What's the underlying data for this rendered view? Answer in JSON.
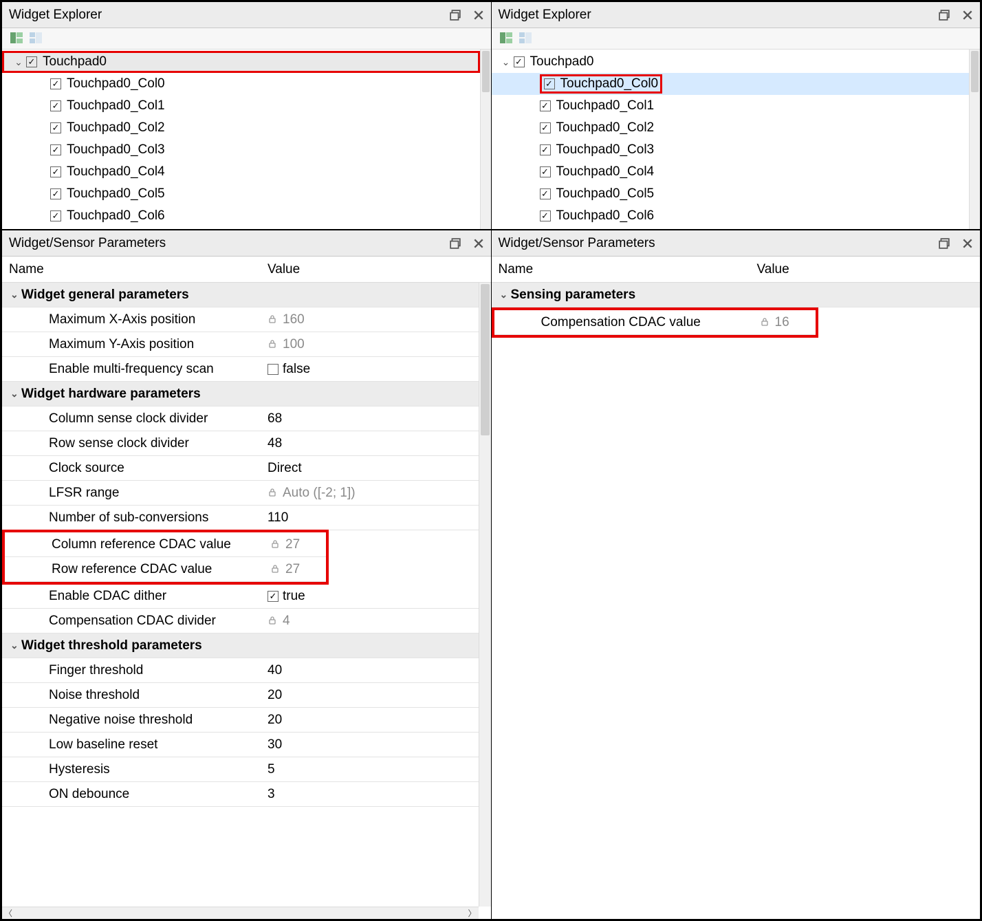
{
  "left": {
    "explorer": {
      "title": "Widget Explorer",
      "root": "Touchpad0",
      "children": [
        "Touchpad0_Col0",
        "Touchpad0_Col1",
        "Touchpad0_Col2",
        "Touchpad0_Col3",
        "Touchpad0_Col4",
        "Touchpad0_Col5",
        "Touchpad0_Col6"
      ]
    },
    "params": {
      "title": "Widget/Sensor Parameters",
      "col_name": "Name",
      "col_value": "Value",
      "groups": [
        {
          "label": "Widget general parameters",
          "items": [
            {
              "name": "Maximum X-Axis position",
              "value": "160",
              "locked": true
            },
            {
              "name": "Maximum Y-Axis position",
              "value": "100",
              "locked": true
            },
            {
              "name": "Enable multi-frequency scan",
              "value": "false",
              "check": false
            }
          ]
        },
        {
          "label": "Widget hardware parameters",
          "items": [
            {
              "name": "Column sense clock divider",
              "value": "68"
            },
            {
              "name": "Row sense clock divider",
              "value": "48"
            },
            {
              "name": "Clock source",
              "value": "Direct"
            },
            {
              "name": "LFSR range",
              "value": "Auto ([-2; 1])",
              "locked": true
            },
            {
              "name": "Number of sub-conversions",
              "value": "110"
            },
            {
              "name": "Column reference CDAC value",
              "value": "27",
              "locked": true,
              "hl": "start"
            },
            {
              "name": "Row reference CDAC value",
              "value": "27",
              "locked": true,
              "hl": "end"
            },
            {
              "name": "Enable CDAC dither",
              "value": "true",
              "check": true
            },
            {
              "name": "Compensation CDAC divider",
              "value": "4",
              "locked": true
            }
          ]
        },
        {
          "label": "Widget threshold parameters",
          "items": [
            {
              "name": "Finger threshold",
              "value": "40"
            },
            {
              "name": "Noise threshold",
              "value": "20"
            },
            {
              "name": "Negative noise threshold",
              "value": "20"
            },
            {
              "name": "Low baseline reset",
              "value": "30"
            },
            {
              "name": "Hysteresis",
              "value": "5"
            },
            {
              "name": "ON debounce",
              "value": "3"
            }
          ]
        }
      ]
    }
  },
  "right": {
    "explorer": {
      "title": "Widget Explorer",
      "root": "Touchpad0",
      "selected_child": "Touchpad0_Col0",
      "children": [
        "Touchpad0_Col0",
        "Touchpad0_Col1",
        "Touchpad0_Col2",
        "Touchpad0_Col3",
        "Touchpad0_Col4",
        "Touchpad0_Col5",
        "Touchpad0_Col6"
      ]
    },
    "params": {
      "title": "Widget/Sensor Parameters",
      "col_name": "Name",
      "col_value": "Value",
      "groups": [
        {
          "label": "Sensing parameters",
          "items": [
            {
              "name": "Compensation CDAC value",
              "value": "16",
              "locked": true,
              "hl": "single"
            }
          ]
        }
      ]
    }
  }
}
